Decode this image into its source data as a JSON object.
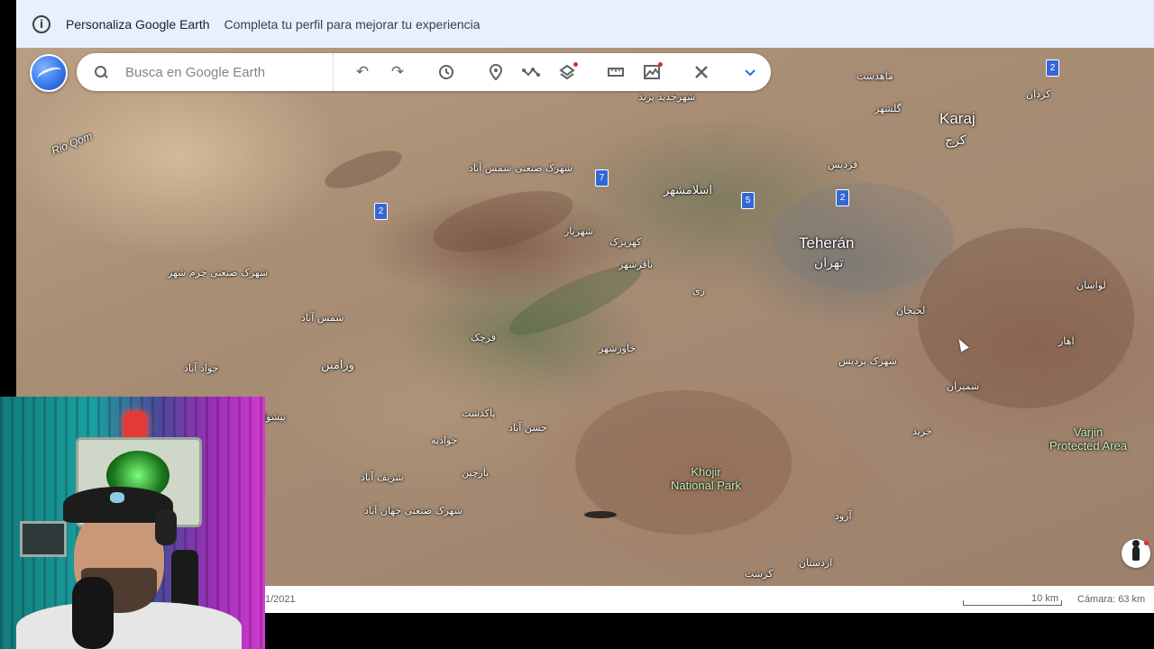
{
  "banner": {
    "title": "Personaliza Google Earth",
    "subtitle": "Completa tu perfil para mejorar tu experiencia",
    "icon": "info-icon"
  },
  "toolbar": {
    "search_placeholder": "Busca en Google Earth",
    "tools": [
      {
        "name": "undo-icon",
        "glyph": "↶"
      },
      {
        "name": "redo-icon",
        "glyph": "↷"
      },
      {
        "name": "history-icon",
        "glyph": "⟲"
      },
      {
        "name": "place-pin-icon",
        "glyph": "📍"
      },
      {
        "name": "path-icon",
        "glyph": "∿"
      },
      {
        "name": "layers-icon",
        "glyph": "◈"
      },
      {
        "name": "ruler-icon",
        "glyph": "▭"
      },
      {
        "name": "data-layers-icon",
        "glyph": "⛰"
      },
      {
        "name": "tools-icon",
        "glyph": "✎"
      },
      {
        "name": "expand-chevron-icon",
        "glyph": "⌄"
      }
    ]
  },
  "map_labels": {
    "rio_qom": "Rio Qom",
    "karaj": "Karaj",
    "karaj_fa": "کرج",
    "tehran": "Teherán",
    "tehran_fa": "تهران",
    "eslamshahr": "اسلامشهر",
    "varamin": "ورامین",
    "shams_abad": "شمس آباد",
    "parand": "شهرک صنعتی شمس آباد",
    "shahr_jadid": "شهرجدید پرند",
    "shahriar": "شهریار",
    "baqershahr": "باقرشهر",
    "khavarshahr": "خاورشهر",
    "pakdasht": "پاکدشت",
    "pishva": "پیشوا",
    "qarchak": "قرچک",
    "lahijan": "لحیجان",
    "kahrizak": "کهریزک",
    "ray": "ری",
    "jawad_abad": "جواد آباد",
    "shahr_sanati": "شهرک صنعتی چرم شهر",
    "mahdasht": "ماهدشت",
    "kordan": "کردان",
    "golshahr": "گلشهر",
    "fardis": "فردیس",
    "lavasan": "لواسان",
    "shemiran": "شمیران",
    "ahar": "اهار",
    "shahrak_pardis": "شهرک پردیس",
    "kharid": "خرید",
    "sharif_abad": "شریف آباد",
    "hasan_abad": "حسن آباد",
    "shahrak_tam": "شهرک صنعتی جهان آباد",
    "javad": "جوادیه",
    "parchin": "پارچین",
    "karasht": "کرشت",
    "ardestan": "اردستان",
    "aref": "آرود",
    "khojir_park": "Khojir\nNational Park",
    "varjin": "Varjin\nProtected Area"
  },
  "markers": [
    {
      "label": "2"
    },
    {
      "label": "7"
    },
    {
      "label": "5"
    },
    {
      "label": "2"
    },
    {
      "label": "2"
    }
  ],
  "status": {
    "date": "1/2021",
    "scale": "10 km",
    "camera": "Cámara: 63 km"
  },
  "colors": {
    "banner_bg": "#e8f0fe",
    "marker": "#3367d6",
    "accent_red": "#d93025"
  }
}
